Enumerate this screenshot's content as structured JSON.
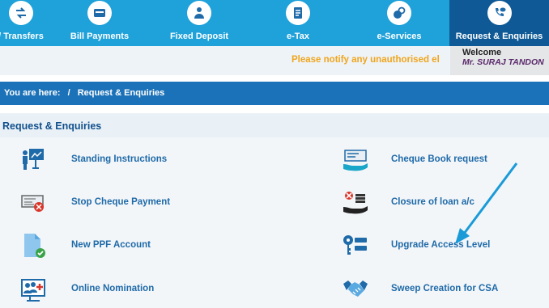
{
  "nav": {
    "items": [
      {
        "label": "/ Transfers"
      },
      {
        "label": "Bill Payments"
      },
      {
        "label": "Fixed Deposit"
      },
      {
        "label": "e-Tax"
      },
      {
        "label": "e-Services"
      },
      {
        "label": "Request & Enquiries"
      }
    ]
  },
  "notice": {
    "marquee": "Please notify any unauthorised ele"
  },
  "welcome": {
    "label": "Welcome",
    "name": "Mr. SURAJ TANDON"
  },
  "breadcrumb": {
    "prefix": "You are here:",
    "separator": "/",
    "current": "Request & Enquiries"
  },
  "section": {
    "title": "Request & Enquiries"
  },
  "left_items": [
    {
      "label": "Standing Instructions",
      "icon": "presentation-board-icon"
    },
    {
      "label": "Stop Cheque Payment",
      "icon": "cheque-cancel-icon"
    },
    {
      "label": "New PPF Account",
      "icon": "document-check-icon"
    },
    {
      "label": "Online Nomination",
      "icon": "nomination-people-icon"
    }
  ],
  "right_items": [
    {
      "label": "Cheque Book request",
      "icon": "cheque-book-hand-icon"
    },
    {
      "label": "Closure of loan a/c",
      "icon": "loan-closure-hand-icon"
    },
    {
      "label": "Upgrade Access Level",
      "icon": "key-access-icon"
    },
    {
      "label": "Sweep Creation for CSA",
      "icon": "handshake-icon"
    }
  ],
  "colors": {
    "nav": "#1fa1d9",
    "nav_active": "#0f5a96",
    "breadcrumb": "#1c72b8",
    "link": "#1f6aa8",
    "notice": "#f0a51d",
    "arrow": "#1a9bd7"
  }
}
